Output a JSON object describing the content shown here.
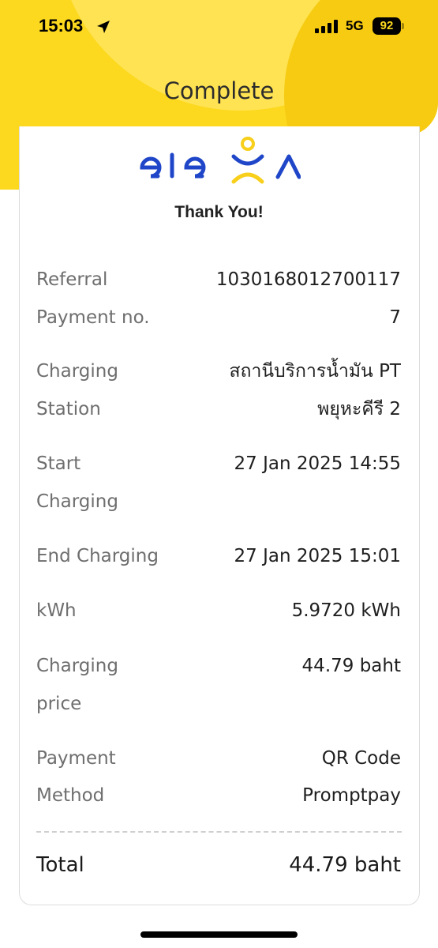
{
  "status_bar": {
    "time": "15:03",
    "network": "5G",
    "battery": "92"
  },
  "header": {
    "title": "Complete",
    "accent_color": "#fcd81e"
  },
  "receipt": {
    "brand": "eleXa",
    "thank_you": "Thank You!",
    "rows": [
      {
        "label": [
          "Referral"
        ],
        "value": [
          "1030168012700117"
        ]
      },
      {
        "label": [
          "Payment no."
        ],
        "value": [
          "7"
        ]
      },
      {
        "label": [
          "Charging",
          "Station"
        ],
        "value": [
          "สถานีบริการน้ำมัน PT",
          "พยุหะคีรี 2"
        ]
      },
      {
        "label": [
          "Start",
          "Charging"
        ],
        "value": [
          "27 Jan 2025 14:55"
        ]
      },
      {
        "label": [
          "End Charging"
        ],
        "value": [
          "27 Jan 2025 15:01"
        ]
      },
      {
        "label": [
          "kWh"
        ],
        "value": [
          "5.9720  kWh"
        ]
      },
      {
        "label": [
          "Charging",
          "price"
        ],
        "value": [
          "44.79  baht"
        ]
      },
      {
        "label": [
          "Payment",
          "Method"
        ],
        "value": [
          "QR Code",
          "Promptpay"
        ]
      }
    ],
    "total_label": "Total",
    "total_value": "44.79  baht"
  }
}
